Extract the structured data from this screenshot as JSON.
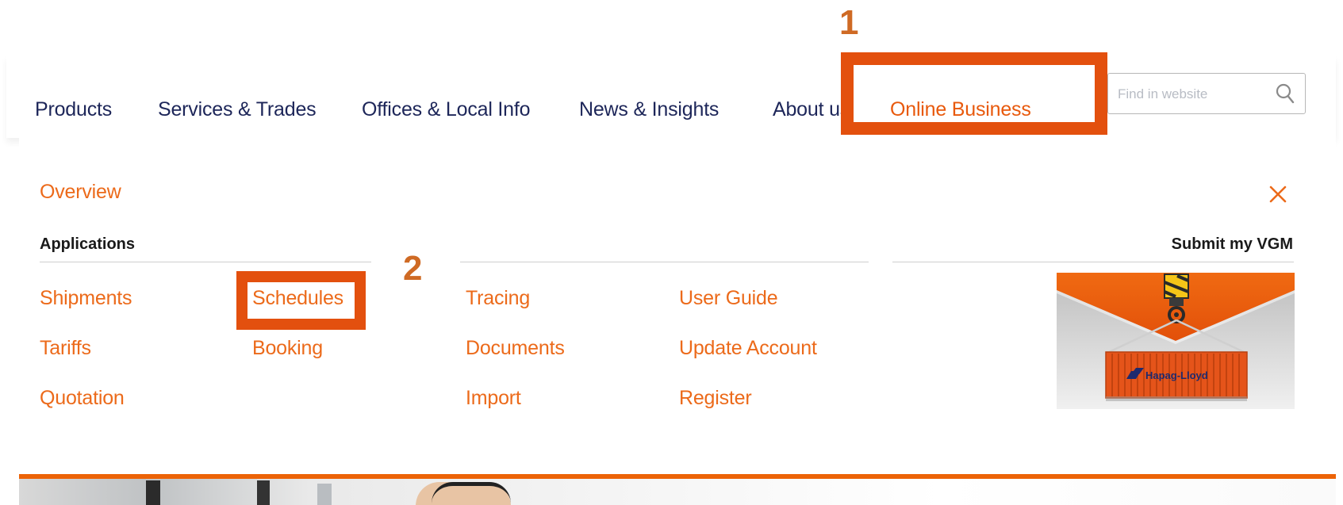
{
  "nav": {
    "items": [
      {
        "label": "Products"
      },
      {
        "label": "Services & Trades"
      },
      {
        "label": "Offices & Local Info"
      },
      {
        "label": "News & Insights"
      },
      {
        "label": "About us"
      },
      {
        "label": "Online Business"
      }
    ],
    "search_placeholder": "Find in website"
  },
  "annotations": {
    "step1": "1",
    "step2": "2"
  },
  "menu": {
    "overview": "Overview",
    "applications_heading": "Applications",
    "vgm_heading": "Submit my VGM",
    "columns": [
      [
        "Shipments",
        "Tariffs",
        "Quotation"
      ],
      [
        "Schedules",
        "Booking"
      ],
      [
        "Tracing",
        "Documents",
        "Import"
      ],
      [
        "User Guide",
        "Update Account",
        "Register"
      ]
    ],
    "vgm_container_text": "Hapag-Lloyd"
  },
  "colors": {
    "accent": "#ec6a1a",
    "callout": "#e3500e",
    "nav_text": "#1d2659"
  },
  "icons": {
    "search": "search-icon",
    "close": "close-icon"
  }
}
